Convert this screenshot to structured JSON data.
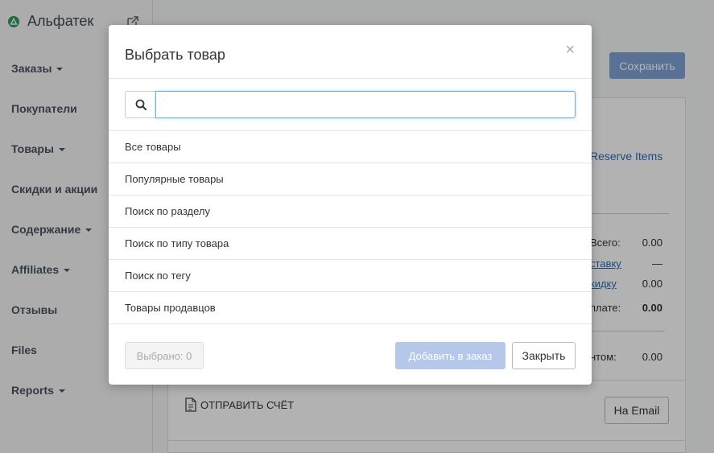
{
  "brand": {
    "name": "Альфатек"
  },
  "sidebar": {
    "items": [
      {
        "label": "Заказы",
        "dropdown": true
      },
      {
        "label": "Покупатели",
        "dropdown": false
      },
      {
        "label": "Товары",
        "dropdown": true
      },
      {
        "label": "Скидки и акции",
        "dropdown": false
      },
      {
        "label": "Содержание",
        "dropdown": true
      },
      {
        "label": "Affiliates",
        "dropdown": true
      },
      {
        "label": "Отзывы",
        "dropdown": false
      },
      {
        "label": "Files",
        "dropdown": false
      },
      {
        "label": "Reports",
        "dropdown": true
      }
    ]
  },
  "main": {
    "save_label": "Сохранить",
    "reserve_label": "Reserve Items",
    "summary": {
      "total_label": "Всего:",
      "total_value": "0.00",
      "shipping_link": "ставку",
      "shipping_value": "—",
      "discount_link": "кидку",
      "discount_value": "0.00",
      "payable_label": "плате:",
      "payable_value": "0.00",
      "client_label": "нтом:",
      "client_value": "0.00"
    },
    "send_invoice_label": "ОТПРАВИТЬ СЧЁТ",
    "email_button_label": "На Email"
  },
  "modal": {
    "title": "Выбрать товар",
    "close_glyph": "×",
    "search": {
      "value": "",
      "placeholder": ""
    },
    "options": [
      "Все товары",
      "Популярные товары",
      "Поиск по разделу",
      "Поиск по типу товара",
      "Поиск по тегу",
      "Товары продавцов"
    ],
    "selected_label": "Выбрано: 0",
    "add_label": "Добавить в заказ",
    "close_label": "Закрыть"
  },
  "colors": {
    "primary": "#2a6ebb",
    "primary_disabled": "#b5c8ea",
    "brand_green": "#2e9a5c",
    "focus_border": "#66afe9"
  },
  "icons": [
    "brand-logo-icon",
    "external-link-icon",
    "search-icon",
    "document-icon",
    "close-icon"
  ]
}
